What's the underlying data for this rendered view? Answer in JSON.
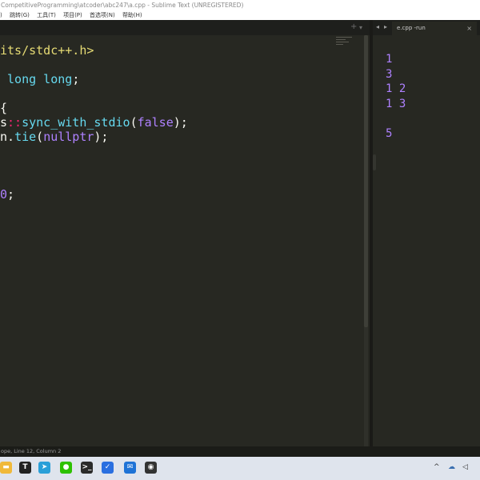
{
  "window": {
    "title": "CompetitiveProgramming\\atcoder\\abc247\\a.cpp - Sublime Text (UNREGISTERED)"
  },
  "menu": {
    "items": [
      ")",
      "跳转(G)",
      "工具(T)",
      "项目(P)",
      "首选项(N)",
      "帮助(H)"
    ]
  },
  "tabs": {
    "left_controls": {
      "add": "+",
      "dropdown": "▾"
    },
    "right": {
      "nav_left": "◂",
      "nav_right": "▸",
      "active_label": "e.cpp -run",
      "close": "×"
    }
  },
  "editor": {
    "lines": [
      [
        {
          "t": "its/stdc++.h>",
          "c": "str"
        }
      ],
      [
        {
          "t": "",
          "c": "pl"
        }
      ],
      [
        {
          "t": " long long",
          "c": "kw"
        },
        {
          "t": ";",
          "c": "pl"
        }
      ],
      [
        {
          "t": "",
          "c": "pl"
        }
      ],
      [
        {
          "t": "{",
          "c": "pl"
        }
      ],
      [
        {
          "t": "s",
          "c": "pl"
        },
        {
          "t": "::",
          "c": "op"
        },
        {
          "t": "sync_with_stdio",
          "c": "fn"
        },
        {
          "t": "(",
          "c": "pl"
        },
        {
          "t": "false",
          "c": "pu"
        },
        {
          "t": ");",
          "c": "pl"
        }
      ],
      [
        {
          "t": "n.",
          "c": "pl"
        },
        {
          "t": "tie",
          "c": "fn"
        },
        {
          "t": "(",
          "c": "pl"
        },
        {
          "t": "nullptr",
          "c": "pu"
        },
        {
          "t": ");",
          "c": "pl"
        }
      ],
      [
        {
          "t": "",
          "c": "pl"
        }
      ],
      [
        {
          "t": "",
          "c": "pl"
        }
      ],
      [
        {
          "t": "",
          "c": "pl"
        }
      ],
      [
        {
          "t": "0",
          "c": "pu"
        },
        {
          "t": ";",
          "c": "pl"
        }
      ]
    ]
  },
  "output": {
    "lines": [
      "1",
      "3",
      "1 2",
      "1 3",
      "",
      "5"
    ]
  },
  "status": {
    "text": "ope, Line 12, Column 2"
  },
  "taskbar": {
    "icons": [
      {
        "name": "folder-icon",
        "glyph": "▬",
        "color": "#f0b93a"
      },
      {
        "name": "typora-icon",
        "glyph": "T",
        "color": "#222222"
      },
      {
        "name": "telegram-icon",
        "glyph": "➤",
        "color": "#2a9fd8"
      },
      {
        "name": "wechat-icon",
        "glyph": "●",
        "color": "#2dc100"
      },
      {
        "name": "terminal-icon",
        "glyph": ">_",
        "color": "#2b2b2b"
      },
      {
        "name": "todo-icon",
        "glyph": "✓",
        "color": "#2a6fe0"
      },
      {
        "name": "mail-icon",
        "glyph": "✉",
        "color": "#1f73d6"
      },
      {
        "name": "obs-icon",
        "glyph": "◉",
        "color": "#333333"
      }
    ],
    "tray": {
      "chevron": "^",
      "cloud": "☁",
      "volume": "◁"
    }
  }
}
